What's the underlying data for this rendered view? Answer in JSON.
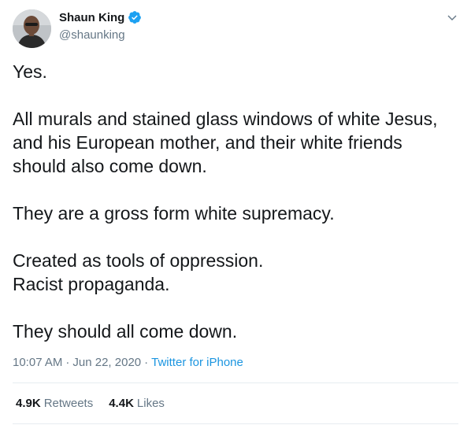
{
  "author": {
    "display_name": "Shaun King",
    "handle": "@shaunking"
  },
  "tweet": {
    "paragraphs": [
      [
        "Yes."
      ],
      [
        "All murals and stained glass windows of white Jesus,",
        "and his European mother, and their white friends",
        "should also come down."
      ],
      [
        "They are a gross form white supremacy."
      ],
      [
        "Created as tools of oppression.",
        "Racist propaganda."
      ],
      [
        "They should all come down."
      ]
    ],
    "time": "10:07 AM",
    "separator": "·",
    "date": "Jun 22, 2020",
    "source": "Twitter for iPhone"
  },
  "stats": {
    "retweets_count": "4.9K",
    "retweets_label": "Retweets",
    "likes_count": "4.4K",
    "likes_label": "Likes"
  },
  "colors": {
    "verified_badge": "#1da1f2",
    "link": "#1b95e0",
    "secondary_text": "#657786"
  }
}
